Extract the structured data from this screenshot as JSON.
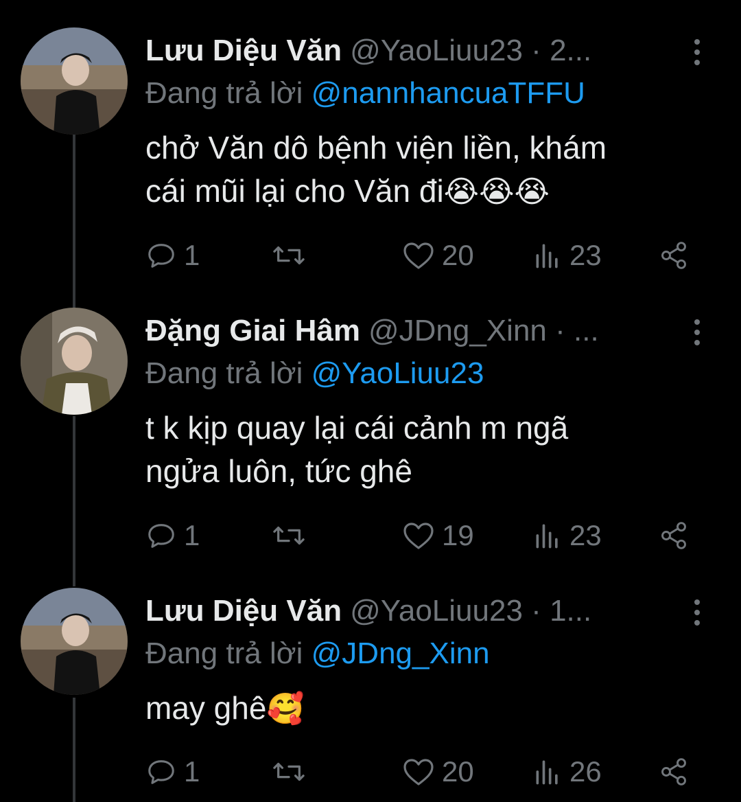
{
  "colors": {
    "background": "#000000",
    "text": "#e7e9ea",
    "muted": "#71767b",
    "mention": "#1d9bf0",
    "thread_line": "#333639"
  },
  "tweets": [
    {
      "name": "Lưu Diệu Văn",
      "handle": "@YaoLiuu23",
      "separator": "·",
      "time": "2...",
      "reply_prefix": "Đang trả lời",
      "reply_mention": "@nannhancuaTFFU",
      "text_line1": "chở Văn dô bệnh viện liền, khám",
      "text_line2": "cái mũi lại cho Văn đi",
      "emoji": "😭😭😭",
      "reply_count": "1",
      "retweet_count": "",
      "like_count": "20",
      "view_count": "23",
      "avatar_icon": "profile-photo"
    },
    {
      "name": "Đặng Giai Hâm",
      "handle": "@JDng_Xinn",
      "separator": "·",
      "time": "...",
      "reply_prefix": "Đang trả lời",
      "reply_mention": "@YaoLiuu23",
      "text_line1": "t k kịp quay lại cái cảnh m ngã",
      "text_line2": "ngửa luôn, tức ghê",
      "emoji": "",
      "reply_count": "1",
      "retweet_count": "",
      "like_count": "19",
      "view_count": "23",
      "avatar_icon": "profile-photo"
    },
    {
      "name": "Lưu Diệu Văn",
      "handle": "@YaoLiuu23",
      "separator": "·",
      "time": "1...",
      "reply_prefix": "Đang trả lời",
      "reply_mention": "@JDng_Xinn",
      "text_line1": "may ghê",
      "text_line2": "",
      "emoji": "🥰",
      "reply_count": "1",
      "retweet_count": "",
      "like_count": "20",
      "view_count": "26",
      "avatar_icon": "profile-photo"
    }
  ],
  "icons": {
    "reply": "reply-icon",
    "retweet": "retweet-icon",
    "like": "heart-icon",
    "views": "views-icon",
    "share": "share-icon",
    "more": "more-vertical-icon"
  }
}
